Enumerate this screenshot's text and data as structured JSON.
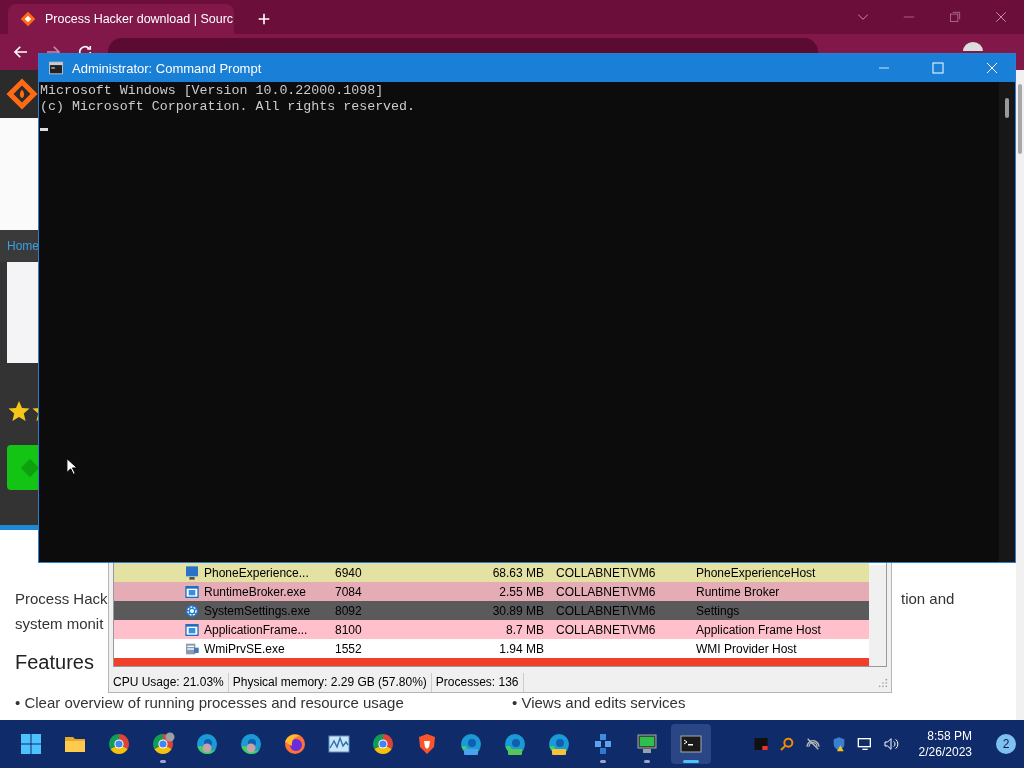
{
  "browser": {
    "tab": {
      "title": "Process Hacker download | Sourc",
      "selected": true
    },
    "page": {
      "breadcrumb": "Home",
      "intro_left": [
        "Process Hack",
        "system monit"
      ],
      "intro_right": "tion and",
      "heading": "Features",
      "features": [
        "• Clear overview of running processes and resource usage",
        "• Views and edits services"
      ]
    }
  },
  "process_hacker": {
    "rows": [
      {
        "kind": "monitor",
        "name": "PhoneExperience...",
        "pid": "6940",
        "memory": "68.63 MB",
        "user": "COLLABNET\\VM6",
        "description": "PhoneExperienceHost",
        "color": "#e4e2a2"
      },
      {
        "kind": "window",
        "name": "RuntimeBroker.exe",
        "pid": "7084",
        "memory": "2.55 MB",
        "user": "COLLABNET\\VM6",
        "description": "Runtime Broker",
        "color": "#e5acb6"
      },
      {
        "kind": "gear",
        "name": "SystemSettings.exe",
        "pid": "8092",
        "memory": "30.89 MB",
        "user": "COLLABNET\\VM6",
        "description": "Settings",
        "color": "#5a5a5a"
      },
      {
        "kind": "window",
        "name": "ApplicationFrame...",
        "pid": "8100",
        "memory": "8.7 MB",
        "user": "COLLABNET\\VM6",
        "description": "Application Frame Host",
        "color": "#ffc0cb"
      },
      {
        "kind": "server",
        "name": "WmiPrvSE.exe",
        "pid": "1552",
        "memory": "1.94 MB",
        "description": "WMI Provider Host",
        "color": "#ffffff"
      },
      {
        "kind": "none",
        "color": "#f0402c"
      }
    ],
    "status_bar": [
      "CPU Usage: 21.03%",
      "Physical memory: 2.29 GB (57.80%)",
      "Processes: 136"
    ]
  },
  "command_prompt": {
    "title": "Administrator: Command Prompt",
    "lines": [
      "Microsoft Windows [Version 10.0.22000.1098]",
      "(c) Microsoft Corporation. All rights reserved."
    ]
  },
  "taskbar": {
    "apps": [
      {
        "kind": "start",
        "running": false,
        "selected": false
      },
      {
        "kind": "folder",
        "running": false,
        "selected": false
      },
      {
        "kind": "chrome",
        "running": false,
        "selected": false
      },
      {
        "kind": "chrome-profile",
        "running": true,
        "selected": false
      },
      {
        "kind": "edge-profile",
        "running": false,
        "selected": false
      },
      {
        "kind": "edge-profile",
        "running": false,
        "selected": false
      },
      {
        "kind": "firefox",
        "running": false,
        "selected": false
      },
      {
        "kind": "chart",
        "running": false,
        "selected": false
      },
      {
        "kind": "chrome",
        "running": false,
        "selected": false
      },
      {
        "kind": "shield",
        "running": false,
        "selected": false
      },
      {
        "kind": "edge-beta",
        "running": false,
        "selected": false
      },
      {
        "kind": "edge-dev",
        "running": false,
        "selected": false
      },
      {
        "kind": "edge-canary",
        "running": false,
        "selected": false
      },
      {
        "kind": "app",
        "running": true,
        "selected": false
      },
      {
        "kind": "computer",
        "running": true,
        "selected": false
      },
      {
        "kind": "terminal",
        "running": true,
        "selected": true
      }
    ],
    "clock": {
      "time": "8:58 PM",
      "date": "2/26/2023"
    },
    "notification_count": "2"
  }
}
